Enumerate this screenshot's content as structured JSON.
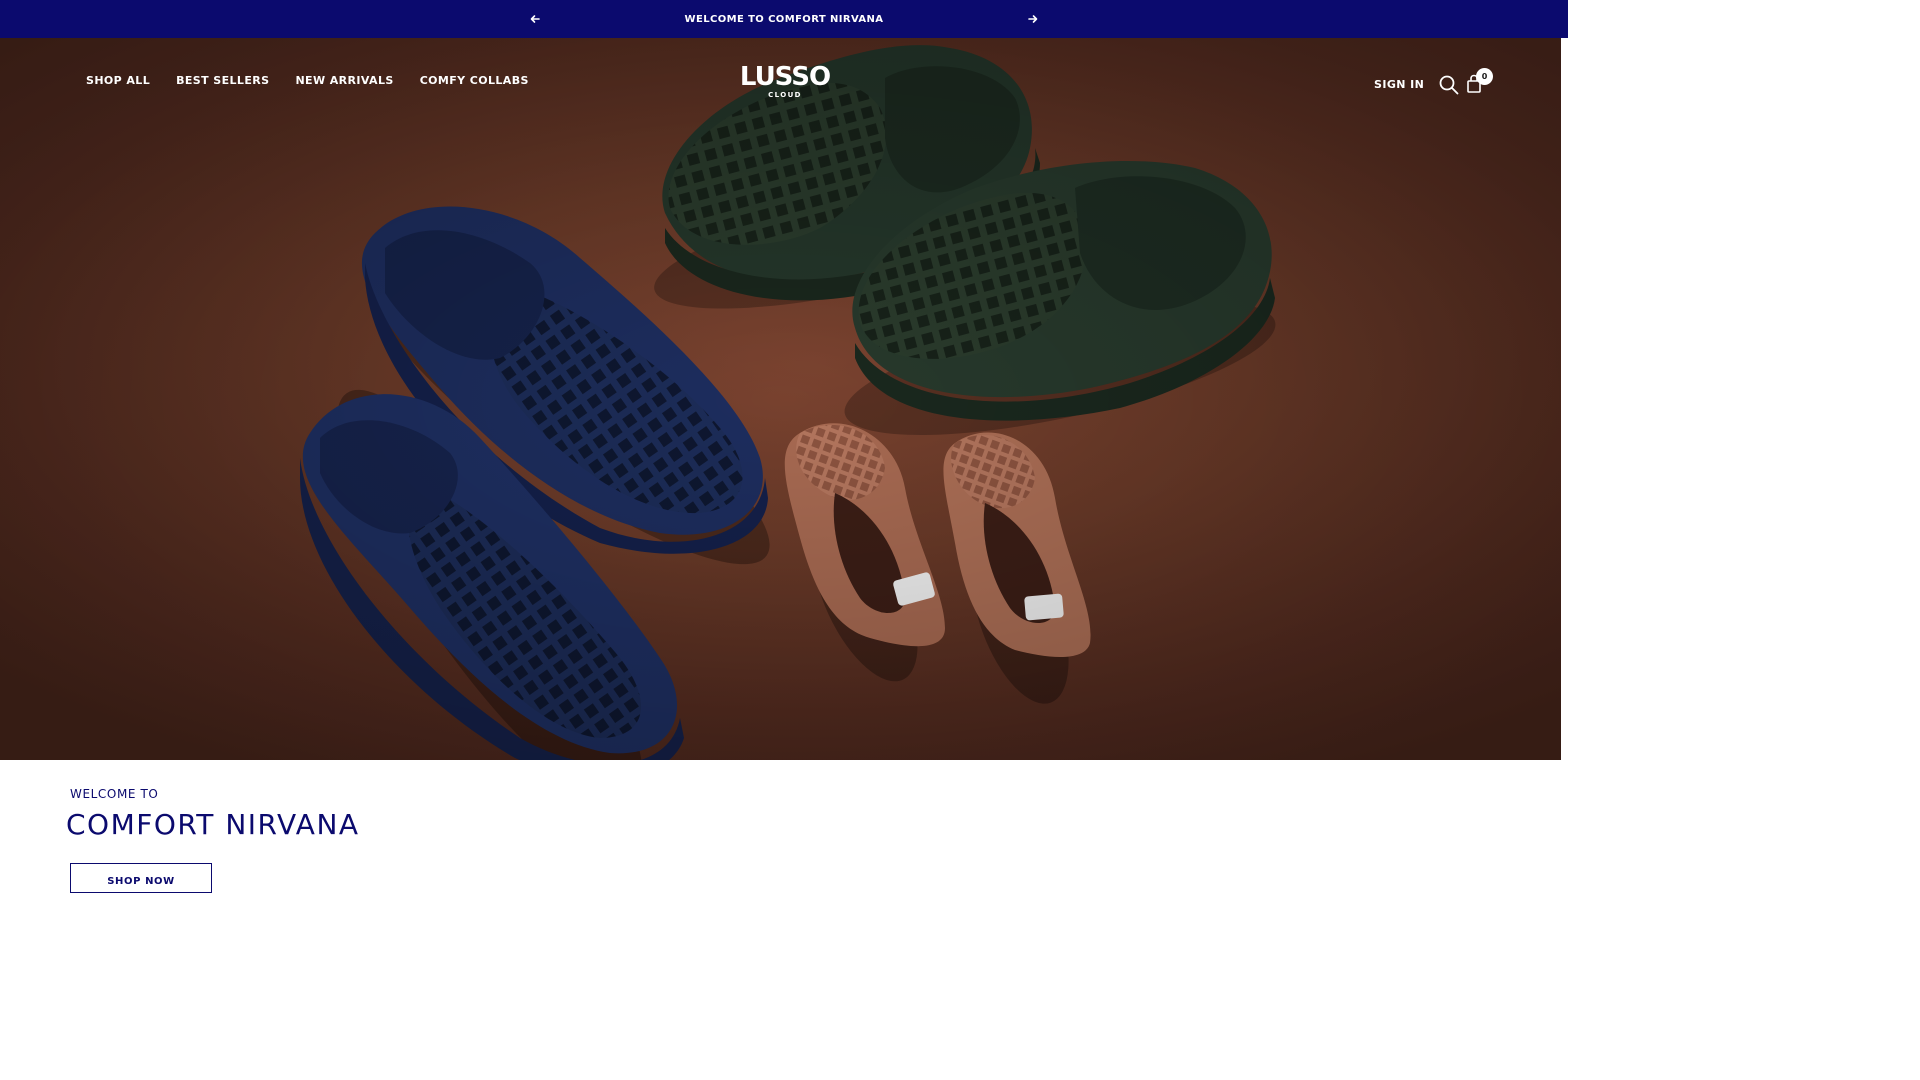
{
  "announcement": {
    "message": "WELCOME TO COMFORT NIRVANA",
    "prev_icon": "arrow-left-icon",
    "next_icon": "arrow-right-icon",
    "background": "#0b0a6e"
  },
  "header": {
    "nav": [
      {
        "label": "SHOP ALL"
      },
      {
        "label": "BEST SELLERS"
      },
      {
        "label": "NEW ARRIVALS"
      },
      {
        "label": "COMFY COLLABS"
      }
    ],
    "logo": {
      "word": "LUSSO",
      "sub": "CLOUD"
    },
    "sign_in": "SIGN IN",
    "search_icon": "search-icon",
    "cart_icon": "shopping-bag-icon",
    "cart_count": "0"
  },
  "hero": {
    "image": "navy, green and brown waffle-textured clogs on a brown background",
    "background": "#6a3a28"
  },
  "intro": {
    "eyebrow": "WELCOME TO",
    "headline": "COMFORT NIRVANA",
    "cta": "SHOP NOW",
    "accent": "#0b0a6e"
  }
}
